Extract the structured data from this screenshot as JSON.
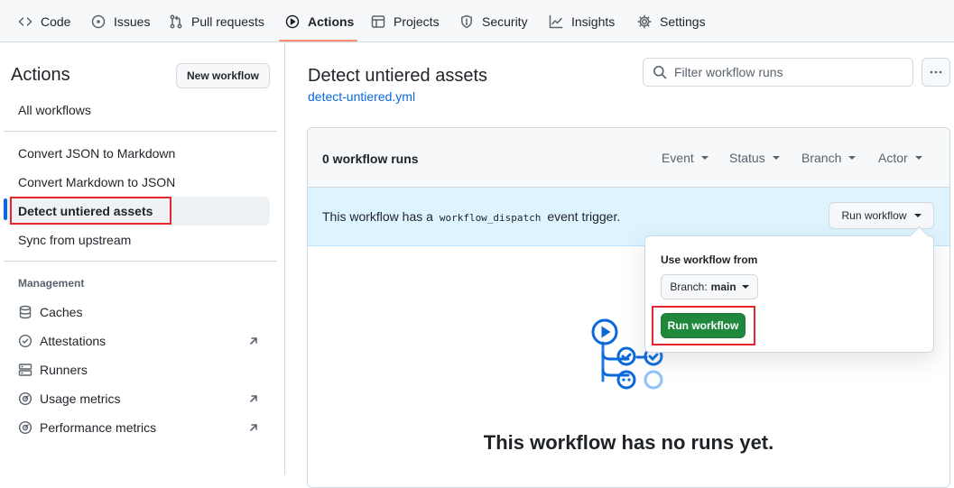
{
  "topnav": {
    "tabs": [
      {
        "label": "Code",
        "icon": "code-icon"
      },
      {
        "label": "Issues",
        "icon": "issue-opened-icon"
      },
      {
        "label": "Pull requests",
        "icon": "git-pull-request-icon"
      },
      {
        "label": "Actions",
        "icon": "play-icon",
        "active": true
      },
      {
        "label": "Projects",
        "icon": "table-icon"
      },
      {
        "label": "Security",
        "icon": "shield-icon"
      },
      {
        "label": "Insights",
        "icon": "graph-icon"
      },
      {
        "label": "Settings",
        "icon": "gear-icon"
      }
    ],
    "active_underline_color": "#fd8c73"
  },
  "sidebar": {
    "title": "Actions",
    "new_workflow_label": "New workflow",
    "all_workflows": "All workflows",
    "workflows": [
      {
        "label": "Convert JSON to Markdown"
      },
      {
        "label": "Convert Markdown to JSON"
      },
      {
        "label": "Detect untiered assets",
        "selected": true
      },
      {
        "label": "Sync from upstream"
      }
    ],
    "management_heading": "Management",
    "management": [
      {
        "label": "Caches",
        "icon": "database-icon"
      },
      {
        "label": "Attestations",
        "icon": "verified-icon",
        "external": true
      },
      {
        "label": "Runners",
        "icon": "server-icon"
      },
      {
        "label": "Usage metrics",
        "icon": "meter-icon",
        "external": true
      },
      {
        "label": "Performance metrics",
        "icon": "meter-icon",
        "external": true
      }
    ]
  },
  "main": {
    "workflow_title": "Detect untiered assets",
    "workflow_file": "detect-untiered.yml",
    "filter_placeholder": "Filter workflow runs",
    "runs_count": "0 workflow runs",
    "filters": [
      "Event",
      "Status",
      "Branch",
      "Actor"
    ],
    "dispatch": {
      "prefix": "This workflow has a",
      "code": "workflow_dispatch",
      "suffix": "event trigger."
    },
    "run_workflow_button": "Run workflow",
    "empty_title": "This workflow has no runs yet."
  },
  "popover": {
    "label": "Use workflow from",
    "branch_prefix": "Branch:",
    "branch_value": "main",
    "submit_label": "Run workflow"
  },
  "colors": {
    "accent_blue": "#0969da",
    "green_button": "#1f883d",
    "highlight_red": "#e5262d",
    "dispatch_bg": "#ddf4ff"
  }
}
